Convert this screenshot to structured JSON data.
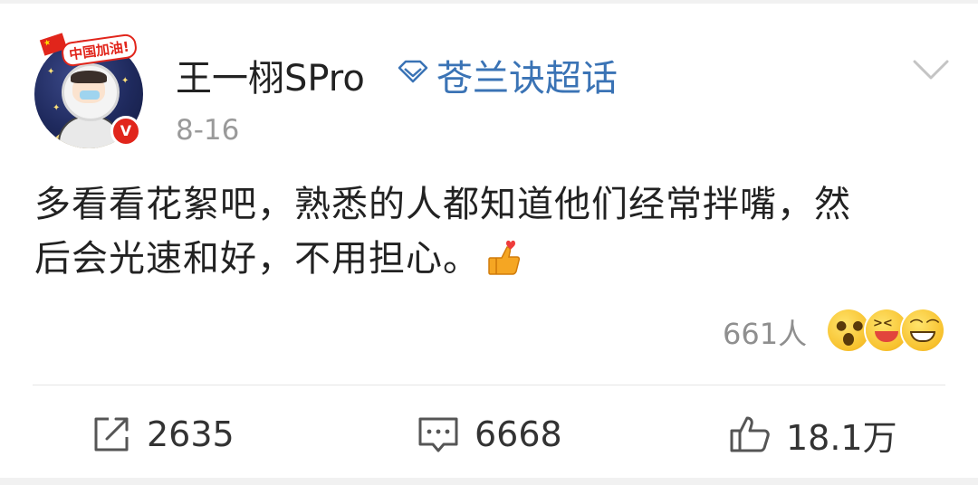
{
  "post": {
    "author": "王一栩SPro",
    "topic": "苍兰诀超话",
    "date": "8-16",
    "text_line1": "多看看花絮吧，熟悉的人都知道他们经常拌嘴，然",
    "text_line2": "后会光速和好，不用担心。",
    "avatar_badge_text": "中国加油!",
    "verified_mark": "V"
  },
  "reactions": {
    "count": "661人",
    "emojis": [
      "surprised-emoji",
      "laughing-emoji",
      "grinning-emoji"
    ]
  },
  "actions": {
    "share_count": "2635",
    "comment_count": "6668",
    "like_count": "18.1万"
  },
  "colors": {
    "topic_blue": "#3a73b5",
    "text_dark": "#222222",
    "meta_gray": "#9a9a9a",
    "verified_red": "#e1251b"
  }
}
